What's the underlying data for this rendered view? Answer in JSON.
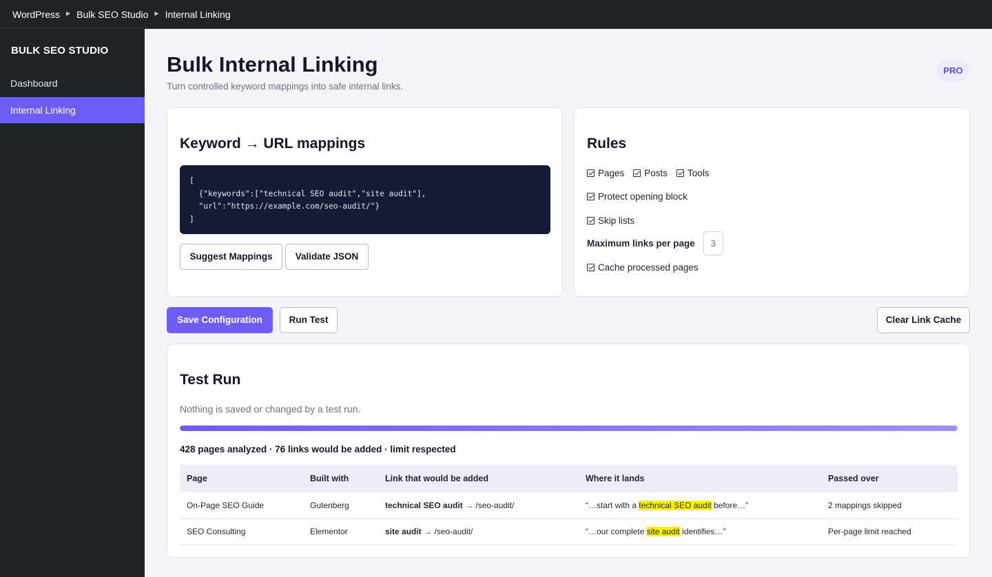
{
  "breadcrumb": [
    "WordPress",
    "Bulk SEO Studio",
    "Internal Linking"
  ],
  "sidebar": {
    "brand": "BULK SEO STUDIO",
    "items": [
      {
        "label": "Dashboard",
        "active": false
      },
      {
        "label": "Internal Linking",
        "active": true
      }
    ]
  },
  "header": {
    "title": "Bulk Internal Linking",
    "subtitle": "Turn controlled keyword mappings into safe internal links.",
    "badge": "PRO"
  },
  "mappings": {
    "title": "Keyword → URL mappings",
    "code": "[\n  {\"keywords\":[\"technical SEO audit\",\"site audit\"],\n  \"url\":\"https://example.com/seo-audit/\"}\n]",
    "suggest_label": "Suggest Mappings",
    "validate_label": "Validate JSON"
  },
  "rules": {
    "title": "Rules",
    "post_types": [
      "Pages",
      "Posts",
      "Tools"
    ],
    "protect_opening": "Protect opening block",
    "skip_lists": "Skip lists",
    "max_links_label": "Maximum links per page",
    "max_links_value": "3",
    "cache_pages": "Cache processed pages"
  },
  "actions": {
    "save_label": "Save Configuration",
    "run_label": "Run Test",
    "clear_label": "Clear Link Cache"
  },
  "test_run": {
    "title": "Test Run",
    "note": "Nothing is saved or changed by a test run.",
    "progress_percent": 100,
    "summary": "428 pages analyzed · 76 links would be added · limit respected",
    "columns": [
      "Page",
      "Built with",
      "Link that would be added",
      "Where it lands",
      "Passed over"
    ],
    "rows": [
      {
        "page": "On-Page SEO Guide",
        "builder": "Gutenberg",
        "anchor": "technical SEO audit",
        "target": " → /seo-audit/",
        "context_before": "“…start with a ",
        "context_match": "technical SEO audit",
        "context_after": " before…”",
        "passed_over": "2 mappings skipped"
      },
      {
        "page": "SEO Consulting",
        "builder": "Elementor",
        "anchor": "site audit",
        "target": " → /seo-audit/",
        "context_before": "“…our complete ",
        "context_match": "site audit",
        "context_after": " identifies…”",
        "passed_over": "Per-page limit reached"
      }
    ]
  },
  "colors": {
    "accent": "#6d5df6",
    "sidebar_bg": "#1e2327",
    "code_bg": "#151a36",
    "highlight": "#fff200"
  }
}
